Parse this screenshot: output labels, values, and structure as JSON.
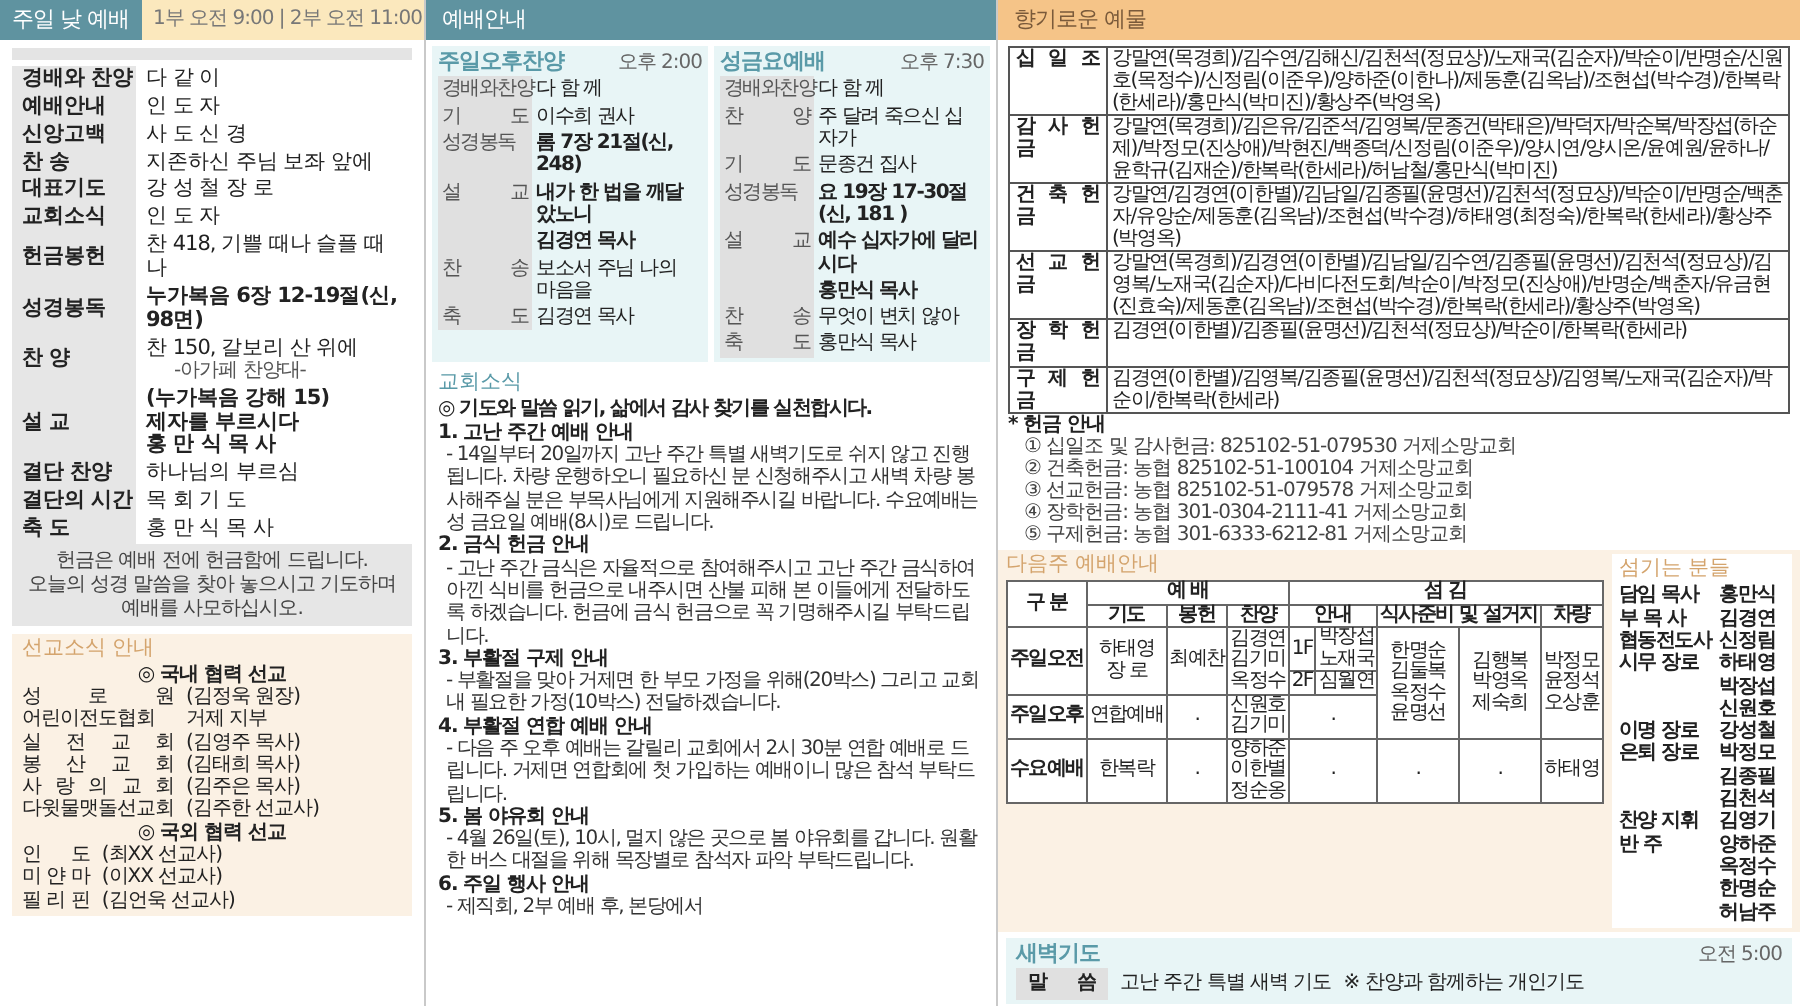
{
  "sunday": {
    "title": "주일 낮 예배",
    "times": "1부 오전 9:00 | 2부 오전 11:00",
    "order": [
      {
        "label": "경배와 찬양",
        "lines": [
          {
            "text": "다 같 이",
            "kind": "main"
          }
        ]
      },
      {
        "label": "예배안내",
        "lines": [
          {
            "text": "인 도 자",
            "kind": "main"
          }
        ]
      },
      {
        "label": "신앙고백",
        "lines": [
          {
            "text": "사 도 신 경",
            "kind": "main"
          }
        ]
      },
      {
        "label": "찬 송",
        "lines": [
          {
            "text": "지존하신 주님 보좌 앞에",
            "kind": "main"
          }
        ]
      },
      {
        "label": "대표기도",
        "lines": [
          {
            "text": "강 성 철 장 로",
            "kind": "main"
          }
        ]
      },
      {
        "label": "교회소식",
        "lines": [
          {
            "text": "인 도 자",
            "kind": "main"
          }
        ]
      },
      {
        "label": "헌금봉헌",
        "lines": [
          {
            "text": "찬 418, 기쁠 때나 슬플 때나",
            "kind": "main"
          }
        ]
      },
      {
        "label": "성경봉독",
        "lines": [
          {
            "text": "누가복음 6장 12-19절(신, 98면)",
            "kind": "emphasis"
          }
        ]
      },
      {
        "label": "찬 양",
        "lines": [
          {
            "text": "찬 150, 갈보리 산 위에",
            "kind": "main"
          },
          {
            "text": "-아가페 찬양대-",
            "kind": "performer"
          }
        ]
      },
      {
        "label": "설 교",
        "lines": [
          {
            "text": "(누가복음 강해 15)",
            "kind": "emphasis"
          },
          {
            "text": "제자를 부르시다",
            "kind": "emphasis"
          },
          {
            "text": "홍 만 식 목 사",
            "kind": "emphasis"
          }
        ]
      },
      {
        "label": "결단 찬양",
        "lines": [
          {
            "text": "하나님의 부르심",
            "kind": "main"
          }
        ]
      },
      {
        "label": "결단의 시간",
        "lines": [
          {
            "text": "목 회 기 도",
            "kind": "main"
          }
        ]
      },
      {
        "label": "축 도",
        "lines": [
          {
            "text": "홍 만 식 목 사",
            "kind": "main"
          }
        ]
      }
    ],
    "notes": [
      "헌금은 예배 전에 헌금함에 드립니다.",
      "오늘의 성경 말씀을 찾아 놓으시고 기도하며 예배를 사모하십시오."
    ]
  },
  "services": {
    "title": "예배안내",
    "blocks": [
      {
        "title": "주일오후찬양",
        "time": "오후 2:00",
        "rows": [
          {
            "label": "경배와찬양",
            "value": "다 함 께",
            "bold": false
          },
          {
            "label": "기 도",
            "value": "이수희 권사",
            "bold": false
          },
          {
            "label": "성경봉독",
            "value": "롬 7장 21절(신, 248)",
            "bold": true
          },
          {
            "label": "설 교",
            "value": "내가 한 법을 깨달았노니",
            "bold": true
          },
          {
            "value": "김경연 목사",
            "bold": true
          },
          {
            "label": "찬 송",
            "value": "보소서 주님 나의 마음을",
            "bold": false
          },
          {
            "label": "축 도",
            "value": "김경연 목사",
            "bold": false
          }
        ]
      },
      {
        "title": "성금요예배",
        "time": "오후 7:30",
        "rows": [
          {
            "label": "경배와찬양",
            "value": "다 함 께",
            "bold": false
          },
          {
            "label": "찬 양",
            "value": "주 달려 죽으신 십자가",
            "bold": false
          },
          {
            "label": "기 도",
            "value": "문종건 집사",
            "bold": false
          },
          {
            "label": "성경봉독",
            "value": "요 19장 17-30절(신, 181 )",
            "bold": true
          },
          {
            "label": "설 교",
            "value": "예수 십자가에 달리시다",
            "bold": true
          },
          {
            "value": "홍만식 목사",
            "bold": true
          },
          {
            "label": "찬 송",
            "value": "무엇이 변치 않아",
            "bold": false
          },
          {
            "label": "축 도",
            "value": "홍만식 목사",
            "bold": false
          }
        ]
      }
    ]
  },
  "dawn": {
    "title": "새벽기도",
    "time": "오전 5:00",
    "label": "말 씀",
    "text": "고난 주간 특별 새벽 기도",
    "note": "※ 찬양과 함께하는 개인기도"
  },
  "news": {
    "title": "교회소식",
    "headline": "◎ 기도와 말씀 읽기, 삶에서 감사 찾기를 실천합시다.",
    "items": [
      {
        "title": "1. 고난 주간 예배 안내",
        "body": "- 14일부터 20일까지 고난 주간 특별 새벽기도로 쉬지 않고 진행됩니다. 차량 운행하오니 필요하신 분 신청해주시고 새벽 차량 봉사해주실 분은 부목사님에게 지원해주시길 바랍니다. 수요예배는 성 금요일 예배(8시)로 드립니다."
      },
      {
        "title": "2. 금식 헌금 안내",
        "body": "- 고난 주간 금식은 자율적으로 참여해주시고 고난 주간 금식하여 아낀 식비를 헌금으로 내주시면 산불 피해 본 이들에게 전달하도록 하겠습니다. 헌금에 금식 헌금으로 꼭 기명해주시길 부탁드립니다."
      },
      {
        "title": "3. 부활절 구제 안내",
        "body": "- 부활절을 맞아 거제면 한 부모 가정을 위해(20박스) 그리고 교회 내 필요한 가정(10박스) 전달하겠습니다."
      },
      {
        "title": "4. 부활절 연합 예배 안내",
        "body": "- 다음 주 오후 예배는 갈릴리 교회에서 2시 30분 연합 예배로 드립니다. 거제면 연합회에 첫 가입하는 예배이니 많은 참석 부탁드립니다."
      },
      {
        "title": "5. 봄 야유회 안내",
        "body": "- 4월 26일(토), 10시, 멀지 않은 곳으로 봄 야유회를 갑니다. 원활한 버스 대절을 위해 목장별로 참석자 파악 부탁드립니다."
      },
      {
        "title": "6. 주일 행사 안내",
        "body": "- 제직회, 2부 예배 후, 본당에서"
      }
    ]
  },
  "offerings": {
    "title": "향기로운 예물",
    "rows": [
      {
        "label": "십 일 조",
        "names": "강말연(목경희)/김수연/김해신/김천석(정묘상)/노재국(김순자)/박순이/반명순/신원호(목정수)/신정림(이준우)/양하준(이한나)/제동훈(김옥남)/조현섭(박수경)/한복락(한세라)/홍만식(박미진)/황상주(박영옥)"
      },
      {
        "label": "감 사 헌 금",
        "names": "강말연(목경희)/김은유/김준석/김영복/문종건(박태은)/박덕자/박순복/박장섭(하순제)/박정모(진상애)/박현진/백종덕/신정림(이준우)/양시연/양시온/윤예원/윤하나/윤학규(김재순)/한복락(한세라)/허남철/홍만식(박미진)"
      },
      {
        "label": "건 축 헌 금",
        "names": "강말연/김경연(이한별)/김남일/김종필(윤명선)/김천석(정묘상)/박순이/반명순/백춘자/유앙순/제동훈(김옥남)/조현섭(박수경)/하태영(최정숙)/한복락(한세라)/황상주(박영옥)"
      },
      {
        "label": "선 교 헌 금",
        "names": "강말연(목경희)/김경연(이한별)/김남일/김수연/김종필(윤명선)/김천석(정묘상)/김영복/노재국(김순자)/다비다전도회/박순이/박정모(진상애)/반명순/백춘자/유금현(진효숙)/제동훈(김옥남)/조현섭(박수경)/한복락(한세라)/황상주(박영옥)"
      },
      {
        "label": "장 학 헌 금",
        "names": "김경연(이한별)/김종필(윤명선)/김천석(정묘상)/박순이/한복락(한세라)"
      },
      {
        "label": "구 제 헌 금",
        "names": "김경연(이한별)/김영복/김종필(윤명선)/김천석(정묘상)/김영복/노재국(김순자)/박순이/한복락(한세라)"
      }
    ],
    "guide_title": "* 헌금 안내",
    "accounts": [
      "① 십일조 및 감사헌금: 825102-51-079530 거제소망교회",
      "② 건축헌금: 농협 825102-51-100104 거제소망교회",
      "③ 선교헌금: 농협 825102-51-079578 거제소망교회",
      "④ 장학헌금: 농협 301-0304-2111-41 거제소망교회",
      "⑤ 구제헌금: 농협 301-6333-6212-81 거제소망교회"
    ]
  },
  "next_week": {
    "title": "다음주 예배안내",
    "group_headers": [
      "구 분",
      "예 배",
      "섬 김"
    ],
    "columns": [
      "기도",
      "봉헌",
      "찬양",
      "안내",
      "식사준비 및 설거지",
      "차량"
    ],
    "rows": [
      {
        "label": "주일오전",
        "prayer": [
          "하태영",
          "장 로"
        ],
        "offering": [
          "최예찬"
        ],
        "praise": [
          "김경연",
          "김기미",
          "옥정수"
        ],
        "guides": [
          {
            "floor": "1F",
            "names": [
              "박장섭",
              "노재국"
            ]
          },
          {
            "floor": "2F",
            "names": [
              "심월연"
            ]
          }
        ],
        "meal": [
          "한명순",
          "김둘복",
          "옥정수",
          "윤명선"
        ],
        "dishes": [
          "김행복",
          "박영옥",
          "제숙희"
        ],
        "driver": [
          "박정모",
          "윤정석",
          "오상훈"
        ]
      },
      {
        "label": "주일오후",
        "prayer": [
          "연합예배"
        ],
        "offering": [
          "."
        ],
        "praise": [
          "신원호",
          "김기미"
        ],
        "guides": [
          {
            "names": [
              "."
            ]
          }
        ]
      },
      {
        "label": "수요예배",
        "prayer": [
          "한복락"
        ],
        "offering": [
          "."
        ],
        "praise": [
          "양하준",
          "이한별",
          "정순옹"
        ],
        "guides": [
          {
            "names": [
              "."
            ]
          }
        ],
        "meal": [
          "."
        ],
        "dishes": [
          "."
        ],
        "driver": [
          "하태영"
        ]
      }
    ]
  },
  "servants": {
    "title": "섬기는 분들",
    "rows": [
      {
        "role": "담임 목사",
        "names": "홍만식"
      },
      {
        "role": "부 목 사",
        "names": "김경연"
      },
      {
        "role": "협동전도사",
        "names": "신정림"
      },
      {
        "role": "시무 장로",
        "names": "하태영 박장섭 신원호"
      },
      {
        "role": "이명 장로",
        "names": "강성철"
      },
      {
        "role": "은퇴 장로",
        "names": "박정모 김종필 김천석"
      },
      {
        "role": "찬양 지휘",
        "names": "김영기"
      },
      {
        "role": "반 주",
        "names": "양하준 옥정수 한명순 허남주"
      }
    ]
  },
  "missions": {
    "title": "선교소식 안내",
    "groups": [
      {
        "title": "◎ 국내 협력 선교",
        "rows": [
          {
            "place": "성 로 원",
            "who": "(김정욱 원장)"
          },
          {
            "place": "어린이전도협회",
            "who": "거제 지부"
          },
          {
            "place": "실 전 교 회",
            "who": "(김영주 목사)"
          },
          {
            "place": "봉 산 교 회",
            "who": "(김태희 목사)"
          },
          {
            "place": "사 랑 의 교 회",
            "who": "(김주은 목사)"
          },
          {
            "place": "다윗물맷돌선교회",
            "who": "(김주한 선교사)"
          }
        ]
      },
      {
        "title": "◎ 국외 협력 선교",
        "rows": [
          {
            "place": "인 도",
            "who": "(최XX 선교사)"
          },
          {
            "place": "미 얀 마",
            "who": "(이XX 선교사)"
          },
          {
            "place": "필 리 핀",
            "who": "(김언욱 선교사)"
          }
        ]
      }
    ]
  }
}
